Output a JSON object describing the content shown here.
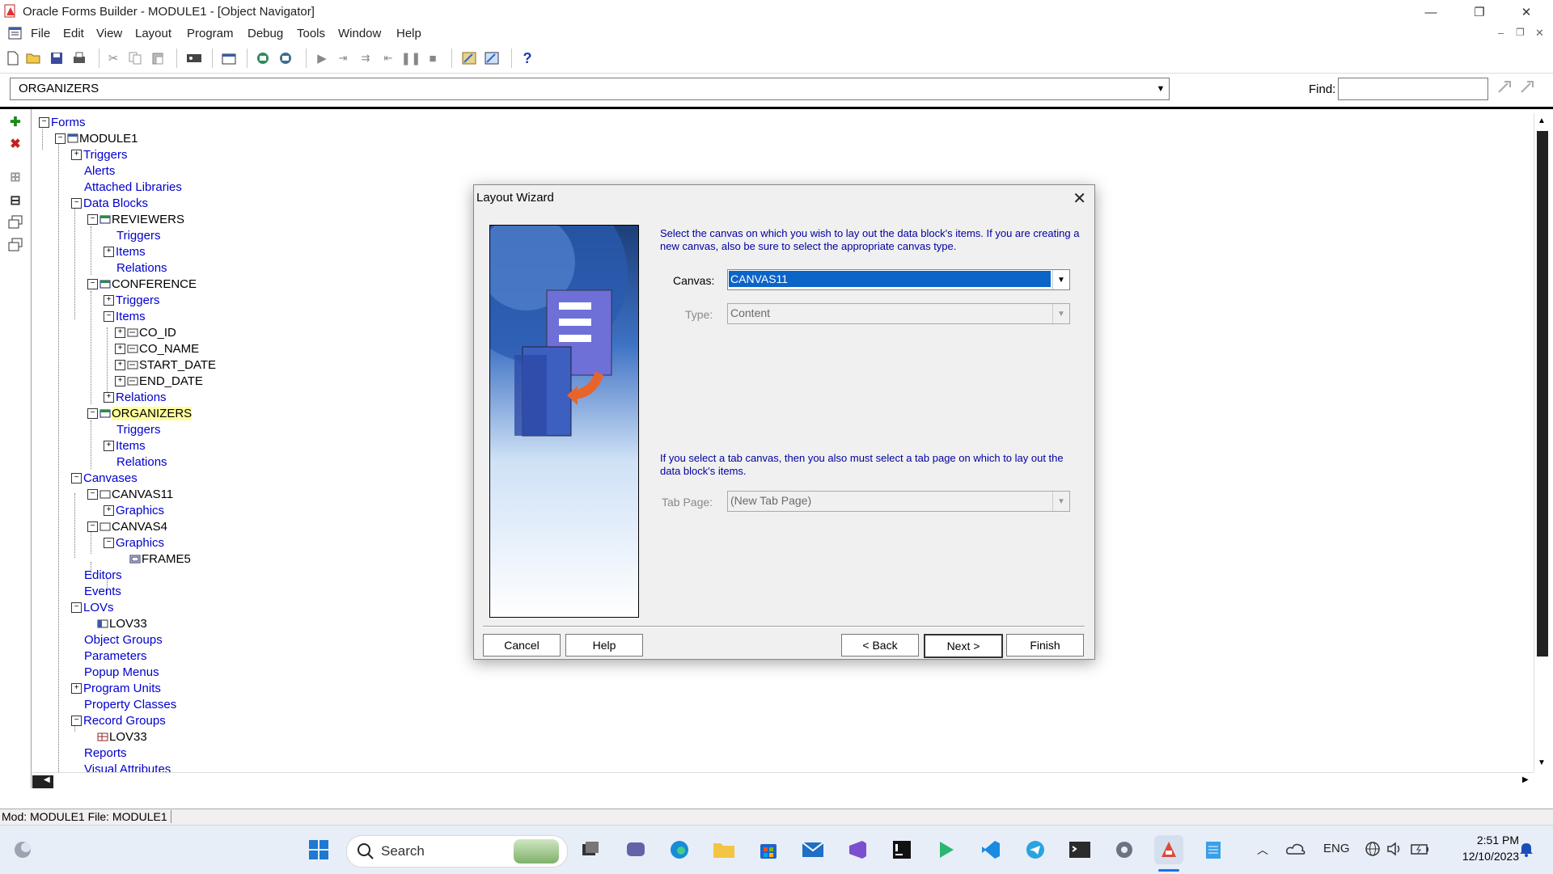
{
  "window": {
    "title": "Oracle Forms Builder - MODULE1 - [Object Navigator]",
    "controls": {
      "minimize": "—",
      "restore": "❐",
      "close": "✕"
    }
  },
  "menubar": {
    "items": [
      "File",
      "Edit",
      "View",
      "Layout",
      "Program",
      "Debug",
      "Tools",
      "Window",
      "Help"
    ],
    "mdi_controls": {
      "minimize": "–",
      "restore": "❐",
      "close": "✕"
    }
  },
  "toolbar": {
    "icons": [
      "new-icon",
      "open-icon",
      "save-icon",
      "print-icon",
      "cut-icon",
      "copy-icon",
      "paste-icon",
      "connect-icon",
      "compile-icon",
      "run-form-icon",
      "debug-icon",
      "go-icon",
      "step-into-icon",
      "step-over-icon",
      "step-out-icon",
      "pause-icon",
      "stop-icon",
      "wizard-icon",
      "layout-wizard-icon",
      "help-icon"
    ],
    "help_glyph": "?"
  },
  "location": {
    "value": "ORGANIZERS",
    "find_label": "Find:",
    "find_value": ""
  },
  "left_toolbar": {
    "create_glyph": "✚",
    "delete_glyph": "✖",
    "expand_glyph": "⊞",
    "collapse_glyph": "⊟"
  },
  "tree": {
    "forms": "Forms",
    "module": "MODULE1",
    "triggers": "Triggers",
    "alerts": "Alerts",
    "attached_libraries": "Attached Libraries",
    "data_blocks": "Data Blocks",
    "reviewers": "REVIEWERS",
    "reviewers_triggers": "Triggers",
    "reviewers_items": "Items",
    "reviewers_relations": "Relations",
    "conference": "CONFERENCE",
    "conference_triggers": "Triggers",
    "conference_items": "Items",
    "co_id": "CO_ID",
    "co_name": "CO_NAME",
    "start_date": "START_DATE",
    "end_date": "END_DATE",
    "conference_relations": "Relations",
    "organizers": "ORGANIZERS",
    "organizers_triggers": "Triggers",
    "organizers_items": "Items",
    "organizers_relations": "Relations",
    "canvases": "Canvases",
    "canvas11": "CANVAS11",
    "canvas11_graphics": "Graphics",
    "canvas4": "CANVAS4",
    "canvas4_graphics": "Graphics",
    "frame5": "FRAME5",
    "editors": "Editors",
    "events": "Events",
    "lovs": "LOVs",
    "lov33": "LOV33",
    "object_groups": "Object Groups",
    "parameters": "Parameters",
    "popup_menus": "Popup Menus",
    "program_units": "Program Units",
    "property_classes": "Property Classes",
    "record_groups": "Record Groups",
    "rg_lov33": "LOV33",
    "reports": "Reports",
    "visual_attributes": "Visual Attributes"
  },
  "status": {
    "text": "Mod: MODULE1 File: MODULE1"
  },
  "dialog": {
    "title": "Layout Wizard",
    "close_glyph": "✕",
    "intro": "Select the canvas on which you wish to lay out the data block's items. If you are creating a new canvas, also be sure to select the appropriate canvas type.",
    "canvas_label": "Canvas:",
    "canvas_value": "CANVAS11",
    "type_label": "Type:",
    "type_value": "Content",
    "tab_info": "If you select a tab canvas, then you also must select a tab page on which to lay out the data block's items.",
    "tabpage_label": "Tab Page:",
    "tabpage_value": "(New Tab Page)",
    "buttons": {
      "cancel": "Cancel",
      "help": "Help",
      "back": "< Back",
      "next": "Next >",
      "finish": "Finish"
    }
  },
  "taskbar": {
    "search_placeholder": "Search",
    "language": "ENG",
    "time": "2:51 PM",
    "date": "12/10/2023"
  }
}
